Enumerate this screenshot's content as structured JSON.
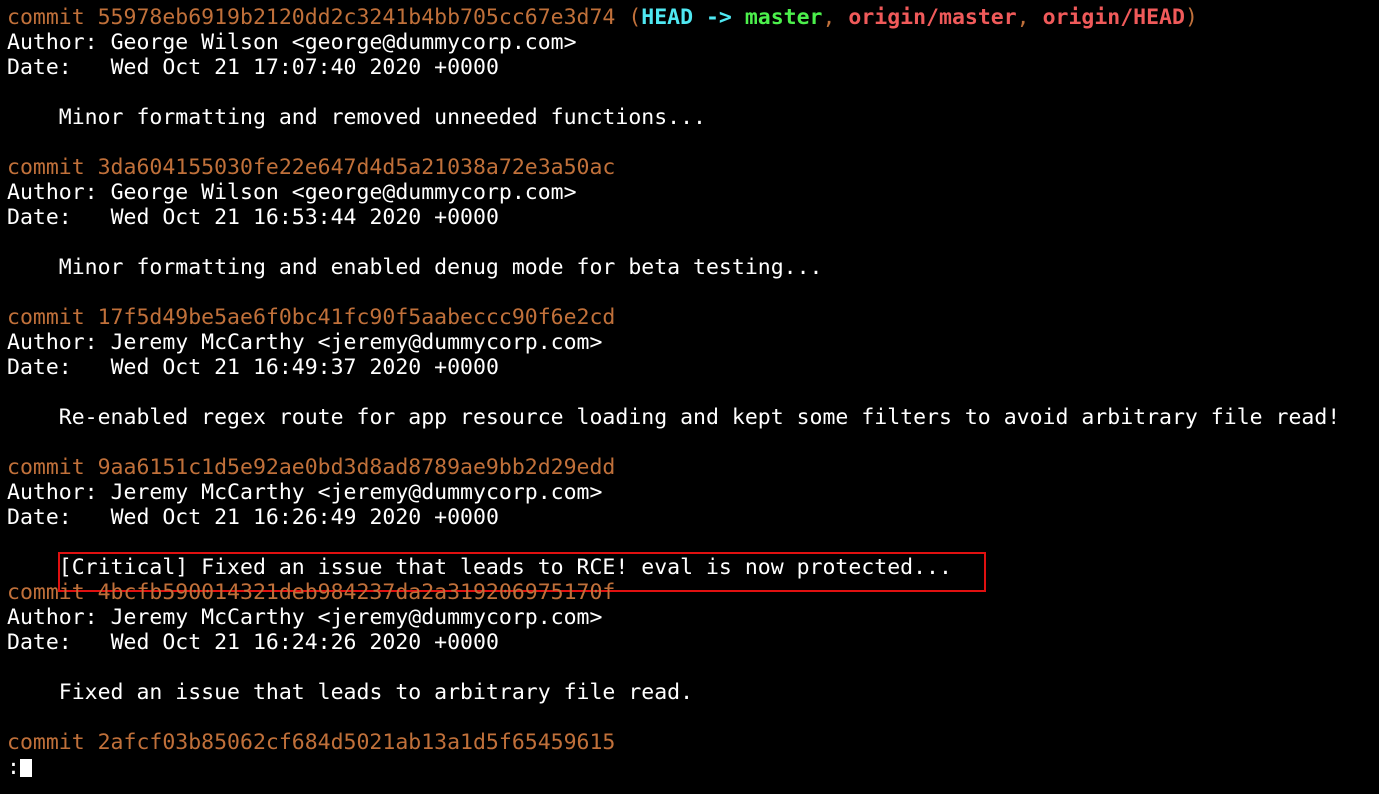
{
  "commits": [
    {
      "hash": "55978eb6919b2120dd2c3241b4bb705cc67e3d74",
      "author": "George Wilson <george@dummycorp.com>",
      "date": "Wed Oct 21 17:07:40 2020 +0000",
      "message": "Minor formatting and removed unneeded functions..."
    },
    {
      "hash": "3da604155030fe22e647d4d5a21038a72e3a50ac",
      "author": "George Wilson <george@dummycorp.com>",
      "date": "Wed Oct 21 16:53:44 2020 +0000",
      "message": "Minor formatting and enabled denug mode for beta testing..."
    },
    {
      "hash": "17f5d49be5ae6f0bc41fc90f5aabeccc90f6e2cd",
      "author": "Jeremy McCarthy <jeremy@dummycorp.com>",
      "date": "Wed Oct 21 16:49:37 2020 +0000",
      "message": "Re-enabled regex route for app resource loading and kept some filters to avoid arbitrary file read!"
    },
    {
      "hash": "9aa6151c1d5e92ae0bd3d8ad8789ae9bb2d29edd",
      "author": "Jeremy McCarthy <jeremy@dummycorp.com>",
      "date": "Wed Oct 21 16:26:49 2020 +0000",
      "message": "[Critical] Fixed an issue that leads to RCE! eval is now protected..."
    },
    {
      "hash": "4bcfb590014321deb984237da2a319206975170f",
      "author": "Jeremy McCarthy <jeremy@dummycorp.com>",
      "date": "Wed Oct 21 16:24:26 2020 +0000",
      "message": "Fixed an issue that leads to arbitrary file read."
    },
    {
      "hash": "2afcf03b85062cf684d5021ab13a1d5f65459615"
    }
  ],
  "labels": {
    "commit": "commit ",
    "author": "Author: ",
    "date": "Date:   ",
    "indent": "    "
  },
  "refs": {
    "open": " (",
    "head": "HEAD",
    "arrow": " -> ",
    "local_branch": "master",
    "comma1": ", ",
    "remote_branch": "origin/master",
    "comma2": ", ",
    "remote_head": "origin/HEAD",
    "close": ")"
  },
  "pager_prompt": ":",
  "colors": {
    "background": "#000000",
    "text": "#ffffff",
    "commit_hash": "#c0703a",
    "ref_head": "#4fe8f2",
    "ref_local": "#4cf04c",
    "ref_remote": "#f05a5a",
    "highlight_box": "#e01010"
  }
}
